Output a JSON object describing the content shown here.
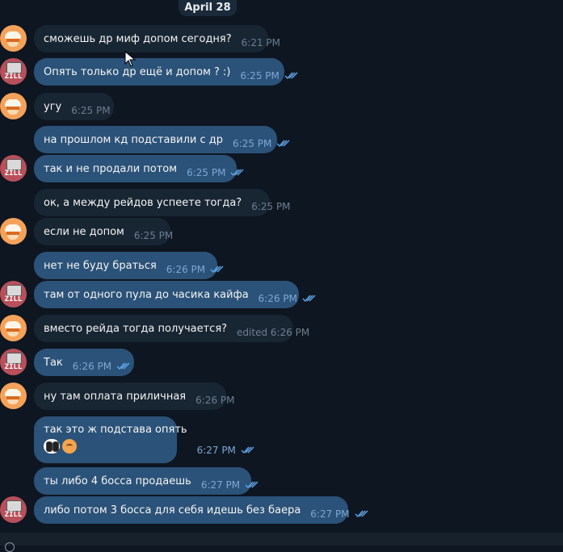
{
  "date_label": "April 28",
  "colors": {
    "background": "#0e1621",
    "incoming": "#182533",
    "outgoing": "#2b5278",
    "check": "#5fa8ee"
  },
  "messages": [
    {
      "dir": "in",
      "avatar": "orange",
      "text": "сможешь др миф допом сегодня?",
      "time": "6:21 PM"
    },
    {
      "dir": "out",
      "avatar": "zill",
      "text": "Опять только др ещё и допом ? :)",
      "time": "6:25 PM"
    },
    {
      "dir": "in",
      "avatar": "orange",
      "text": "угу",
      "time": "6:25 PM"
    },
    {
      "dir": "out",
      "avatar": "",
      "text": "на прошлом кд подставили с др",
      "time": "6:25 PM"
    },
    {
      "dir": "out",
      "avatar": "zill",
      "text": "так и не продали потом",
      "time": "6:25 PM"
    },
    {
      "dir": "in",
      "avatar": "",
      "text": "ок, а между рейдов успеете тогда?",
      "time": "6:25 PM"
    },
    {
      "dir": "in",
      "avatar": "orange",
      "text": "если не допом",
      "time": "6:25 PM"
    },
    {
      "dir": "out",
      "avatar": "",
      "text": "нет не буду браться",
      "time": "6:26 PM"
    },
    {
      "dir": "out",
      "avatar": "zill",
      "text": "там от одного пула до часика кайфа",
      "time": "6:26 PM"
    },
    {
      "dir": "in",
      "avatar": "orange",
      "text": "вместо рейда тогда получается?",
      "time": "edited 6:26 PM"
    },
    {
      "dir": "out",
      "avatar": "zill",
      "text": "Так",
      "time": "6:26 PM"
    },
    {
      "dir": "in",
      "avatar": "orange",
      "text": "ну там оплата приличная",
      "time": "6:26 PM"
    },
    {
      "dir": "out",
      "avatar": "",
      "text": "так это ж подстава опять",
      "time": "6:27 PM",
      "reactions": [
        "eyes",
        "smiley"
      ]
    },
    {
      "dir": "out",
      "avatar": "",
      "text": "ты либо 4 босса продаешь",
      "time": "6:27 PM"
    },
    {
      "dir": "out",
      "avatar": "zill",
      "text": "либо потом 3 босса для себя идешь без баера",
      "time": "6:27 PM"
    }
  ],
  "avatar_zill_label": "ZILL"
}
